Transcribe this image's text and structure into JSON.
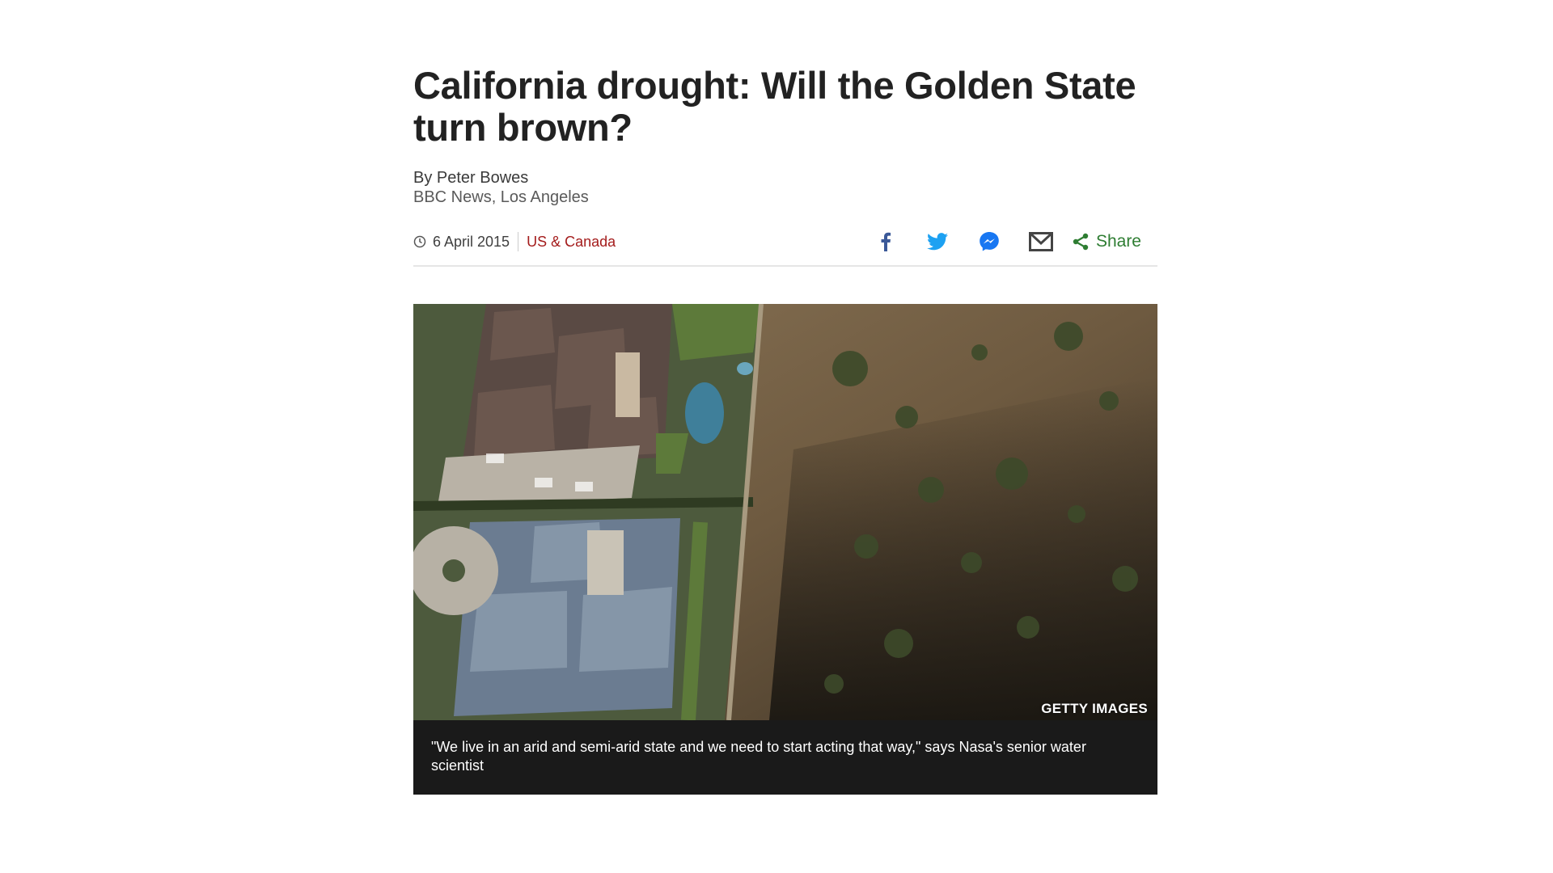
{
  "article": {
    "headline": "California drought: Will the Golden State turn brown?",
    "author": "By Peter Bowes",
    "author_role": "BBC News, Los Angeles",
    "date": "6 April 2015",
    "section": "US & Canada"
  },
  "share": {
    "label": "Share",
    "icons": [
      "facebook-icon",
      "twitter-icon",
      "messenger-icon",
      "email-icon",
      "share-icon"
    ]
  },
  "figure": {
    "credit": "GETTY IMAGES",
    "caption": "\"We live in an arid and semi-arid state and we need to start acting that way,\" says Nasa's senior water scientist"
  },
  "colors": {
    "headline": "#222222",
    "section_link": "#a41c1c",
    "share_green": "#2e7d32",
    "facebook": "#3b5998",
    "twitter": "#1da1f2",
    "messenger": "#1877f2",
    "caption_bg": "#1a1a1a"
  }
}
